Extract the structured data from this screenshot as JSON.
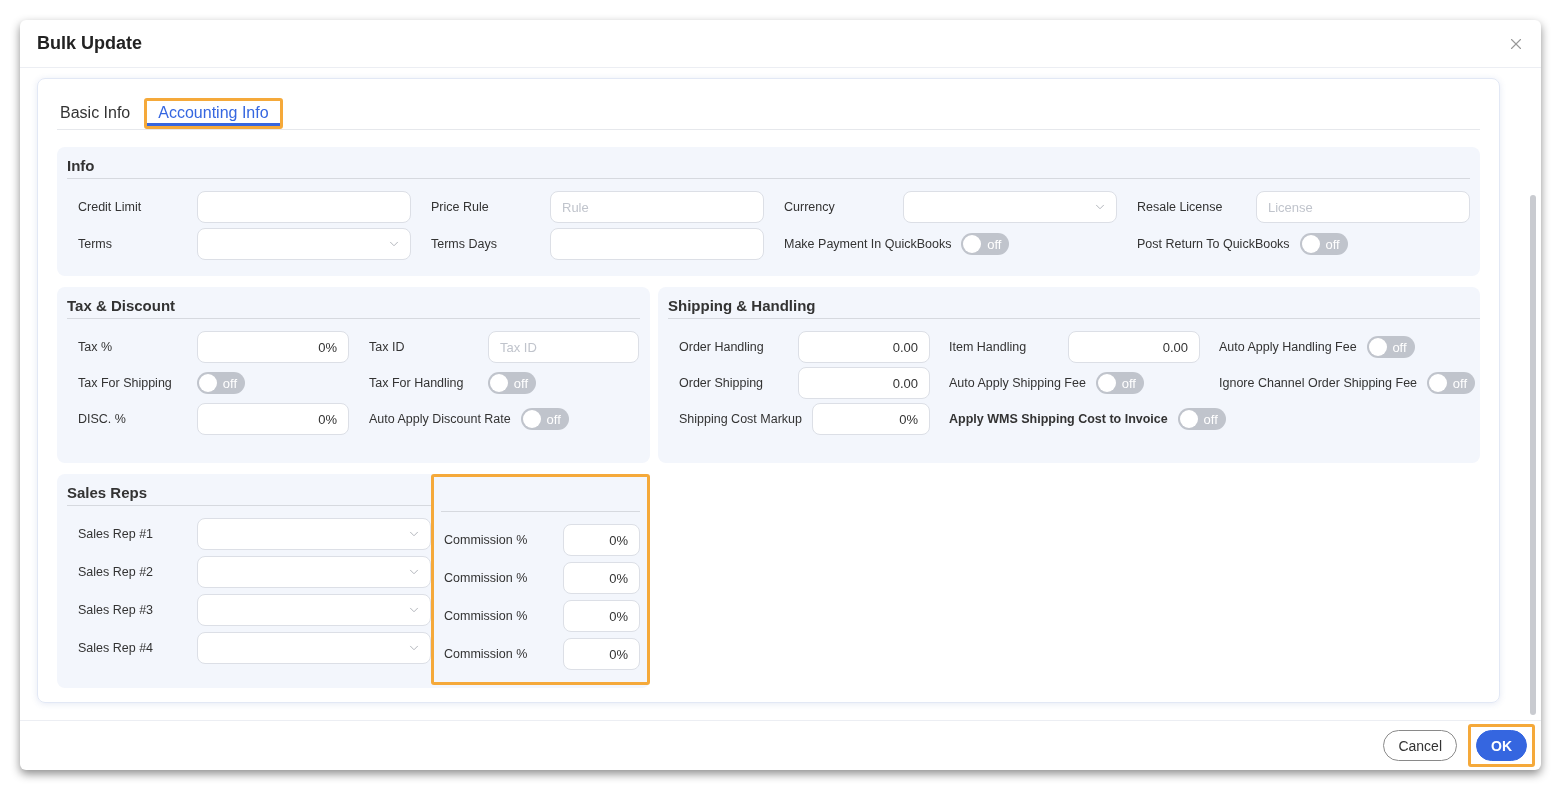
{
  "dialog": {
    "title": "Bulk Update"
  },
  "tabs": [
    {
      "label": "Basic Info",
      "selected": false,
      "highlighted": false
    },
    {
      "label": "Accounting Info",
      "selected": true,
      "highlighted": true
    }
  ],
  "info": {
    "title": "Info",
    "fields": [
      {
        "kind": "input",
        "label": "Credit Limit"
      },
      {
        "kind": "input",
        "label": "Price Rule",
        "placeholder": "Rule"
      },
      {
        "kind": "select",
        "label": "Currency"
      },
      {
        "kind": "input",
        "label": "Resale License",
        "placeholder": "License"
      },
      {
        "kind": "select",
        "label": "Terms"
      },
      {
        "kind": "input",
        "label": "Terms Days"
      },
      {
        "kind": "toggle",
        "label": "Make Payment In QuickBooks",
        "on": false,
        "text": "off"
      },
      {
        "kind": "toggle",
        "label": "Post Return To QuickBooks",
        "on": false,
        "text": "off"
      }
    ]
  },
  "tax_discount": {
    "title": "Tax & Discount",
    "fields": [
      {
        "kind": "input",
        "label": "Tax %",
        "value": "0%"
      },
      {
        "kind": "input",
        "label": "Tax ID",
        "placeholder": "Tax ID"
      },
      {
        "kind": "toggle",
        "label": "Tax For Shipping",
        "on": false,
        "text": "off"
      },
      {
        "kind": "toggle",
        "label": "Tax For Handling",
        "on": false,
        "text": "off"
      },
      {
        "kind": "input",
        "label": "DISC. %",
        "value": "0%"
      },
      {
        "kind": "toggle",
        "label": "Auto Apply Discount Rate",
        "on": false,
        "text": "off"
      }
    ]
  },
  "shipping_handling": {
    "title": "Shipping & Handling",
    "fields": [
      {
        "kind": "input",
        "label": "Order Handling",
        "value": "0.00"
      },
      {
        "kind": "input",
        "label": "Item Handling",
        "value": "0.00"
      },
      {
        "kind": "toggle",
        "label": "Auto Apply Handling Fee",
        "on": false,
        "text": "off"
      },
      {
        "kind": "input",
        "label": "Order Shipping",
        "value": "0.00"
      },
      {
        "kind": "toggle",
        "label": "Auto Apply Shipping Fee",
        "on": false,
        "text": "off"
      },
      {
        "kind": "toggle",
        "label": "Ignore Channel Order Shipping Fee",
        "on": false,
        "text": "off"
      },
      {
        "kind": "input",
        "label": "Shipping Cost Markup",
        "value": "0%"
      },
      {
        "kind": "toggle",
        "label": "Apply WMS Shipping Cost to Invoice",
        "on": false,
        "text": "off",
        "bold": true
      }
    ]
  },
  "sales_reps": {
    "title": "Sales Reps",
    "reps": [
      {
        "kind": "select",
        "label": "Sales Rep #1"
      },
      {
        "kind": "select",
        "label": "Sales Rep #2"
      },
      {
        "kind": "select",
        "label": "Sales Rep #3"
      },
      {
        "kind": "select",
        "label": "Sales Rep #4"
      }
    ],
    "commission": {
      "highlighted": true,
      "fields": [
        {
          "kind": "input",
          "label": "Commission %",
          "value": "0%"
        },
        {
          "kind": "input",
          "label": "Commission %",
          "value": "0%"
        },
        {
          "kind": "input",
          "label": "Commission %",
          "value": "0%"
        },
        {
          "kind": "input",
          "label": "Commission %",
          "value": "0%"
        }
      ]
    }
  },
  "footer": {
    "buttons": [
      {
        "label": "Cancel",
        "kind": "secondary",
        "highlighted": false
      },
      {
        "label": "OK",
        "kind": "primary",
        "highlighted": true
      }
    ]
  }
}
